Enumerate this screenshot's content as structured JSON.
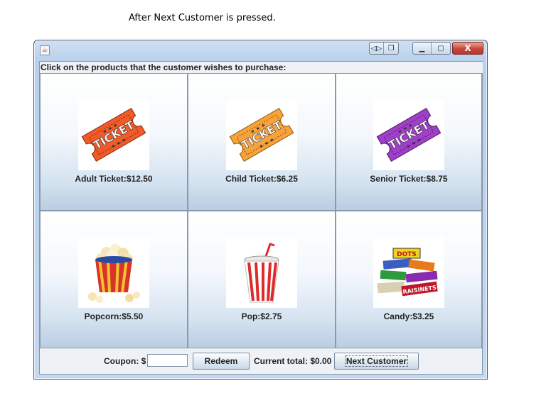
{
  "caption": "After Next Customer is pressed.",
  "window": {
    "title": "",
    "controls": {
      "minimize_icon": "minimize-icon",
      "maximize_icon": "maximize-icon",
      "close_label": "X"
    }
  },
  "instructions": "Click on the products that the customer wishes to purchase:",
  "products": [
    {
      "label": "Adult Ticket:$12.50",
      "icon": "ticket-icon",
      "color": "#f05a28"
    },
    {
      "label": "Child Ticket:$6.25",
      "icon": "ticket-icon",
      "color": "#f7a23a"
    },
    {
      "label": "Senior Ticket:$8.75",
      "icon": "ticket-icon",
      "color": "#a03fc8"
    },
    {
      "label": "Popcorn:$5.50",
      "icon": "popcorn-icon",
      "color": "#d8342a"
    },
    {
      "label": "Pop:$2.75",
      "icon": "soda-cup-icon",
      "color": "#e02a2a"
    },
    {
      "label": "Candy:$3.25",
      "icon": "candy-boxes-icon",
      "color": "#3b5fc0"
    }
  ],
  "footer": {
    "coupon_label": "Coupon: $",
    "coupon_value": "",
    "redeem_label": "Redeem",
    "total_label": "Current total: $0.00",
    "next_label": "Next Customer"
  }
}
